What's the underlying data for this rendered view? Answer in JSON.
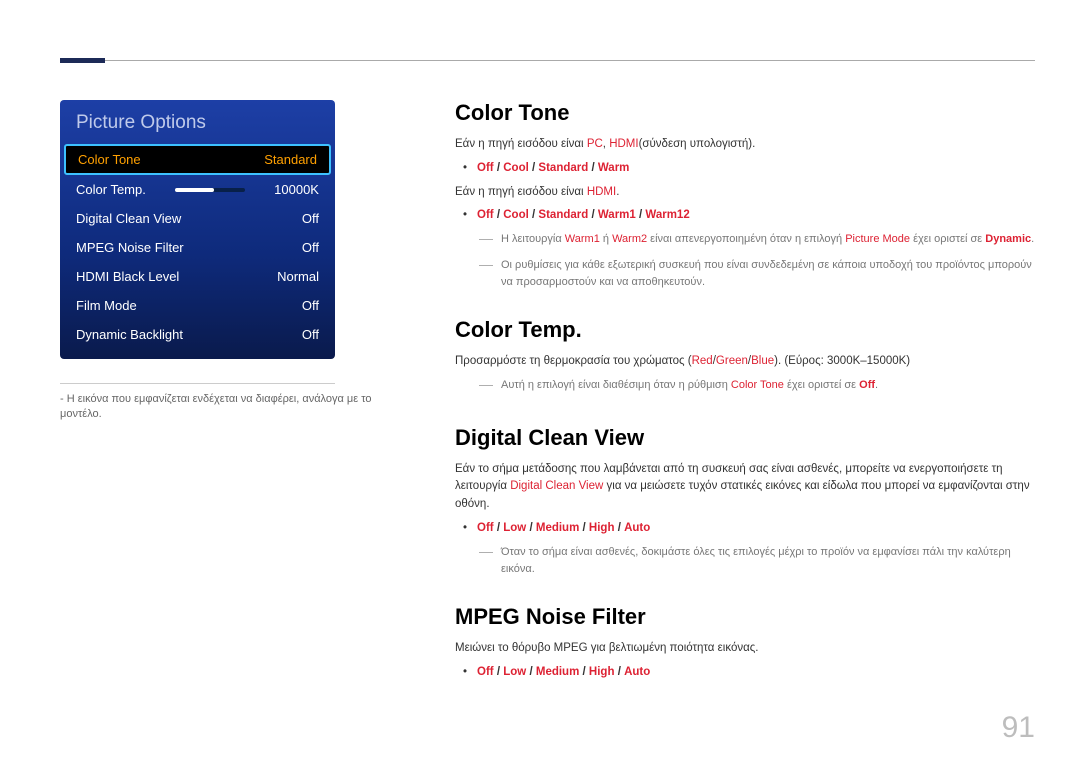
{
  "pageNumber": "91",
  "menu": {
    "title": "Picture Options",
    "caption_prefix": "-",
    "caption": "Η εικόνα που εμφανίζεται ενδέχεται να διαφέρει, ανάλογα με το μοντέλο.",
    "items": [
      {
        "label": "Color Tone",
        "value": "Standard",
        "selected": true
      },
      {
        "label": "Color Temp.",
        "value": "10000K",
        "slider": true
      },
      {
        "label": "Digital Clean View",
        "value": "Off"
      },
      {
        "label": "MPEG Noise Filter",
        "value": "Off"
      },
      {
        "label": "HDMI Black Level",
        "value": "Normal"
      },
      {
        "label": "Film Mode",
        "value": "Off"
      },
      {
        "label": "Dynamic Backlight",
        "value": "Off"
      }
    ]
  },
  "sections": {
    "colorTone": {
      "title": "Color Tone",
      "p1a": "Εάν η πηγή εισόδου είναι ",
      "p1_kw1": "PC",
      "p1_sep": ", ",
      "p1_kw2": "HDMI",
      "p1b": "(σύνδεση υπολογιστή).",
      "opts1": {
        "a": "Off",
        "b": "Cool",
        "c": "Standard",
        "d": "Warm"
      },
      "p2a": "Εάν η πηγή εισόδου είναι ",
      "p2_kw": "HDMI",
      "p2b": ".",
      "opts2": {
        "a": "Off",
        "b": "Cool",
        "c": "Standard",
        "d": "Warm1",
        "e": "Warm12"
      },
      "note1a": "Η λειτουργία ",
      "note1_kw1": "Warm1",
      "note1_mid": " ή ",
      "note1_kw2": "Warm2",
      "note1b": " είναι απενεργοποιημένη όταν η επιλογή ",
      "note1_kw3": "Picture Mode",
      "note1c": " έχει οριστεί σε ",
      "note1_kw4": "Dynamic",
      "note1d": ".",
      "note2": "Οι ρυθμίσεις για κάθε εξωτερική συσκευή που είναι συνδεδεμένη σε κάποια υποδοχή του προϊόντος μπορούν να προσαρμοστούν και να αποθηκευτούν."
    },
    "colorTemp": {
      "title": "Color Temp.",
      "p1a": "Προσαρμόστε τη θερμοκρασία του χρώματος (",
      "p1_kw1": "Red",
      "p1_s1": "/",
      "p1_kw2": "Green",
      "p1_s2": "/",
      "p1_kw3": "Blue",
      "p1b": "). (Εύρος: 3000K–15000K)",
      "note1a": "Αυτή η επιλογή είναι διαθέσιμη όταν η ρύθμιση ",
      "note1_kw1": "Color Tone",
      "note1b": " έχει οριστεί σε ",
      "note1_kw2": "Off",
      "note1c": "."
    },
    "dcv": {
      "title": "Digital Clean View",
      "p1a": "Εάν το σήμα μετάδοσης που λαμβάνεται από τη συσκευή σας είναι ασθενές, μπορείτε να ενεργοποιήσετε τη λειτουργία ",
      "p1_kw": "Digital Clean View",
      "p1b": " για να μειώσετε τυχόν στατικές εικόνες και είδωλα που μπορεί να εμφανίζονται στην οθόνη.",
      "opts": {
        "a": "Off",
        "b": "Low",
        "c": "Medium",
        "d": "High",
        "e": "Auto"
      },
      "note1": "Όταν το σήμα είναι ασθενές, δοκιμάστε όλες τις επιλογές μέχρι το προϊόν να εμφανίσει πάλι την καλύτερη εικόνα."
    },
    "mpeg": {
      "title": "MPEG Noise Filter",
      "p1": "Μειώνει το θόρυβο MPEG για βελτιωμένη ποιότητα εικόνας.",
      "opts": {
        "a": "Off",
        "b": "Low",
        "c": "Medium",
        "d": "High",
        "e": "Auto"
      }
    }
  }
}
